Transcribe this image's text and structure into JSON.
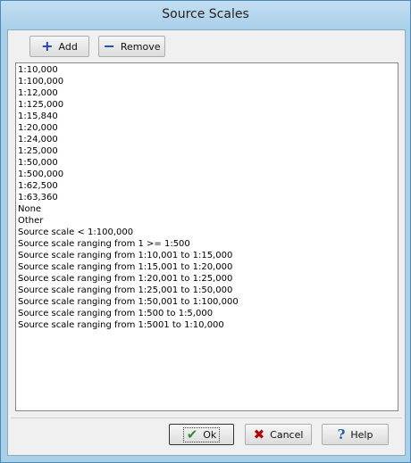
{
  "window": {
    "title": "Source Scales"
  },
  "toolbar": {
    "add_label": "Add",
    "add_icon": "plus-icon",
    "remove_label": "Remove",
    "remove_icon": "minus-icon"
  },
  "list": {
    "items": [
      "1:10,000",
      "1:100,000",
      "1:12,000",
      "1:125,000",
      "1:15,840",
      "1:20,000",
      "1:24,000",
      "1:25,000",
      "1:50,000",
      "1:500,000",
      "1:62,500",
      "1:63,360",
      "None",
      "Other",
      "Source scale < 1:100,000",
      "Source scale ranging from 1 >= 1:500",
      "Source scale ranging from 1:10,001 to 1:15,000",
      "Source scale ranging from 1:15,001 to 1:20,000",
      "Source scale ranging from 1:20,001 to 1:25,000",
      "Source scale ranging from 1:25,001 to 1:50,000",
      "Source scale ranging from 1:50,001 to 1:100,000",
      "Source scale ranging from 1:500 to 1:5,000",
      "Source scale ranging from 1:5001 to 1:10,000"
    ]
  },
  "footer": {
    "ok_label": "Ok",
    "ok_icon": "checkmark-icon",
    "cancel_label": "Cancel",
    "cancel_icon": "x-icon",
    "help_label": "Help",
    "help_icon": "question-icon"
  },
  "colors": {
    "frame": "#a9cfe9",
    "client": "#f0f0f0",
    "list_bg": "#ffffff",
    "accent_blue": "#1b3fbf",
    "ok_green": "#2f8d2f",
    "cancel_red": "#b40000"
  }
}
